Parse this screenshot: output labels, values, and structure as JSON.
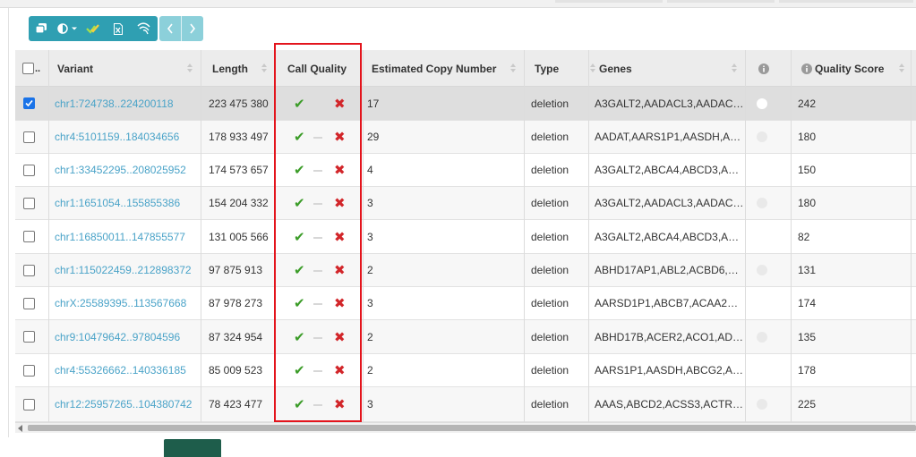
{
  "toolbar": {
    "buttons": [
      {
        "icon": "copy-icon"
      },
      {
        "icon": "contrast-icon",
        "dropdown": true
      },
      {
        "icon": "check-marks-icon"
      },
      {
        "icon": "excel-icon"
      },
      {
        "icon": "dna-icon"
      }
    ],
    "nav": [
      {
        "icon": "chevron-left-icon"
      },
      {
        "icon": "chevron-right-icon"
      }
    ]
  },
  "table": {
    "columns": {
      "select": "",
      "variant": "Variant",
      "length": "Length",
      "call_quality": "Call Quality",
      "copy_number": "Estimated Copy Number",
      "type": "Type",
      "genes": "Genes",
      "info": "",
      "quality_score": "Quality Score"
    },
    "rows": [
      {
        "selected": true,
        "variant": "chr1:724738..224200118",
        "length": "223 475 380",
        "copy_number": "17",
        "type": "deletion",
        "genes": "A3GALT2,AADACL3,AADAC…",
        "info_dot": "white",
        "quality_score": "242",
        "quality_marks": [
          "ok",
          "bad"
        ]
      },
      {
        "selected": false,
        "variant": "chr4:5101159..184034656",
        "length": "178 933 497",
        "copy_number": "29",
        "type": "deletion",
        "genes": "AADAT,AARS1P1,AASDH,A…",
        "info_dot": "grey",
        "quality_score": "180",
        "quality_marks": [
          "ok",
          "mid",
          "bad"
        ]
      },
      {
        "selected": false,
        "variant": "chr1:33452295..208025952",
        "length": "174 573 657",
        "copy_number": "4",
        "type": "deletion",
        "genes": "A3GALT2,ABCA4,ABCD3,A…",
        "info_dot": "none",
        "quality_score": "150",
        "quality_marks": [
          "ok",
          "mid",
          "bad"
        ]
      },
      {
        "selected": false,
        "variant": "chr1:1651054..155855386",
        "length": "154 204 332",
        "copy_number": "3",
        "type": "deletion",
        "genes": "A3GALT2,AADACL3,AADAC…",
        "info_dot": "grey",
        "quality_score": "180",
        "quality_marks": [
          "ok",
          "mid",
          "bad"
        ]
      },
      {
        "selected": false,
        "variant": "chr1:16850011..147855577",
        "length": "131 005 566",
        "copy_number": "3",
        "type": "deletion",
        "genes": "A3GALT2,ABCA4,ABCD3,A…",
        "info_dot": "none",
        "quality_score": "82",
        "quality_marks": [
          "ok",
          "mid",
          "bad"
        ]
      },
      {
        "selected": false,
        "variant": "chr1:115022459..212898372",
        "length": "97 875 913",
        "copy_number": "2",
        "type": "deletion",
        "genes": "ABHD17AP1,ABL2,ACBD6,…",
        "info_dot": "grey",
        "quality_score": "131",
        "quality_marks": [
          "ok",
          "mid",
          "bad"
        ]
      },
      {
        "selected": false,
        "variant": "chrX:25589395..113567668",
        "length": "87 978 273",
        "copy_number": "3",
        "type": "deletion",
        "genes": "AARSD1P1,ABCB7,ACAA2…",
        "info_dot": "none",
        "quality_score": "174",
        "quality_marks": [
          "ok",
          "mid",
          "bad"
        ]
      },
      {
        "selected": false,
        "variant": "chr9:10479642..97804596",
        "length": "87 324 954",
        "copy_number": "2",
        "type": "deletion",
        "genes": "ABHD17B,ACER2,ACO1,AD…",
        "info_dot": "grey",
        "quality_score": "135",
        "quality_marks": [
          "ok",
          "mid",
          "bad"
        ]
      },
      {
        "selected": false,
        "variant": "chr4:55326662..140336185",
        "length": "85 009 523",
        "copy_number": "2",
        "type": "deletion",
        "genes": "AARS1P1,AASDH,ABCG2,A…",
        "info_dot": "none",
        "quality_score": "178",
        "quality_marks": [
          "ok",
          "mid",
          "bad"
        ]
      },
      {
        "selected": false,
        "variant": "chr12:25957265..104380742",
        "length": "78 423 477",
        "copy_number": "3",
        "type": "deletion",
        "genes": "AAAS,ABCD2,ACSS3,ACTR…",
        "info_dot": "grey",
        "quality_score": "225",
        "quality_marks": [
          "ok",
          "mid",
          "bad"
        ]
      }
    ]
  },
  "colors": {
    "toolbar": "#2f9fb2",
    "toolbar_nav": "#8cd0da",
    "link": "#4aa3c8",
    "ok": "#3b9c28",
    "bad": "#d2262a",
    "highlight_box": "#e3141c"
  }
}
